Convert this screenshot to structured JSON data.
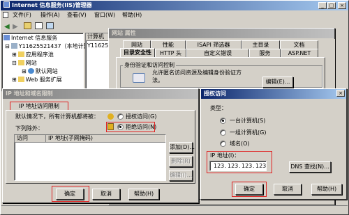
{
  "main_window": {
    "title": "Internet 信息服务(IIS)管理器",
    "menu": [
      "文件(F)",
      "操作(A)",
      "查看(V)",
      "窗口(W)",
      "帮助(H)"
    ]
  },
  "tree": {
    "root": "Internet 信息服务",
    "server": "Y11625521437（本地计算",
    "items": [
      "应用程序池",
      "网站",
      "默认网站",
      "Web 服务扩展"
    ]
  },
  "list_header": "计算机",
  "list_item": "Y1162552",
  "props_window": {
    "title": "网站 属性",
    "tabs_row1": [
      "网站",
      "性能",
      "ISAPI 筛选器",
      "主目录",
      "文档"
    ],
    "tabs_row2": [
      "目录安全性",
      "HTTP 头",
      "自定义错误",
      "服务",
      "ASP.NET"
    ],
    "auth_group": "身份验证和访问控制",
    "auth_text": "允许匿名访问资源及编辑身份验证方",
    "auth_text2": "法。",
    "edit_button": "编辑(E)..."
  },
  "ip_dialog": {
    "title": "IP 地址和域名限制",
    "tab": "IP 地址访问限制",
    "default_text": "默认情况下，所有计算机都将被：",
    "grant": "授权访问(G)",
    "deny": "拒绝访问(N)",
    "except": "下列除外：",
    "col_access": "访问",
    "col_ip": "IP 地址(子网掩码)",
    "add": "添加(D)...",
    "remove": "删除(R)",
    "edit": "编辑(I)...",
    "ok": "确定",
    "cancel": "取消",
    "help": "帮助(H)"
  },
  "grant_dialog": {
    "title": "授权访问",
    "type_label": "类型：",
    "single": "一台计算机(S)",
    "group": "一组计算机(G)",
    "domain": "域名(O)",
    "ip_label": "IP 地址(I)：",
    "ip_octets": [
      "123",
      "123",
      "123",
      "123"
    ],
    "dns": "DNS 查找(N)...",
    "ok": "确定",
    "cancel": "取消",
    "help": "帮助(H)"
  },
  "colors": {
    "title_active": "#0a246a",
    "highlight": "#e02020"
  }
}
